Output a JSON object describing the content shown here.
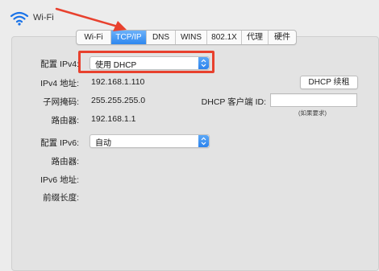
{
  "header": {
    "title": "Wi-Fi",
    "icon": "wifi-icon"
  },
  "tabs": [
    {
      "label": "Wi-Fi",
      "active": false
    },
    {
      "label": "TCP/IP",
      "active": true
    },
    {
      "label": "DNS",
      "active": false
    },
    {
      "label": "WINS",
      "active": false
    },
    {
      "label": "802.1X",
      "active": false
    },
    {
      "label": "代理",
      "active": false
    },
    {
      "label": "硬件",
      "active": false
    }
  ],
  "ipv4": {
    "config_label": "配置 IPv4:",
    "config_value": "使用 DHCP",
    "address_label": "IPv4 地址:",
    "address_value": "192.168.1.110",
    "subnet_label": "子网掩码:",
    "subnet_value": "255.255.255.0",
    "router_label": "路由器:",
    "router_value": "192.168.1.1"
  },
  "dhcp": {
    "renew_button": "DHCP 续租",
    "client_id_label": "DHCP 客户端 ID:",
    "client_id_value": "",
    "client_id_hint": "(如果要求)"
  },
  "ipv6": {
    "config_label": "配置 IPv6:",
    "config_value": "自动",
    "router_label": "路由器:",
    "address_label": "IPv6 地址:",
    "prefix_label": "前缀长度:"
  },
  "colors": {
    "accent": "#2d87ef",
    "annotation": "#e8412e"
  }
}
